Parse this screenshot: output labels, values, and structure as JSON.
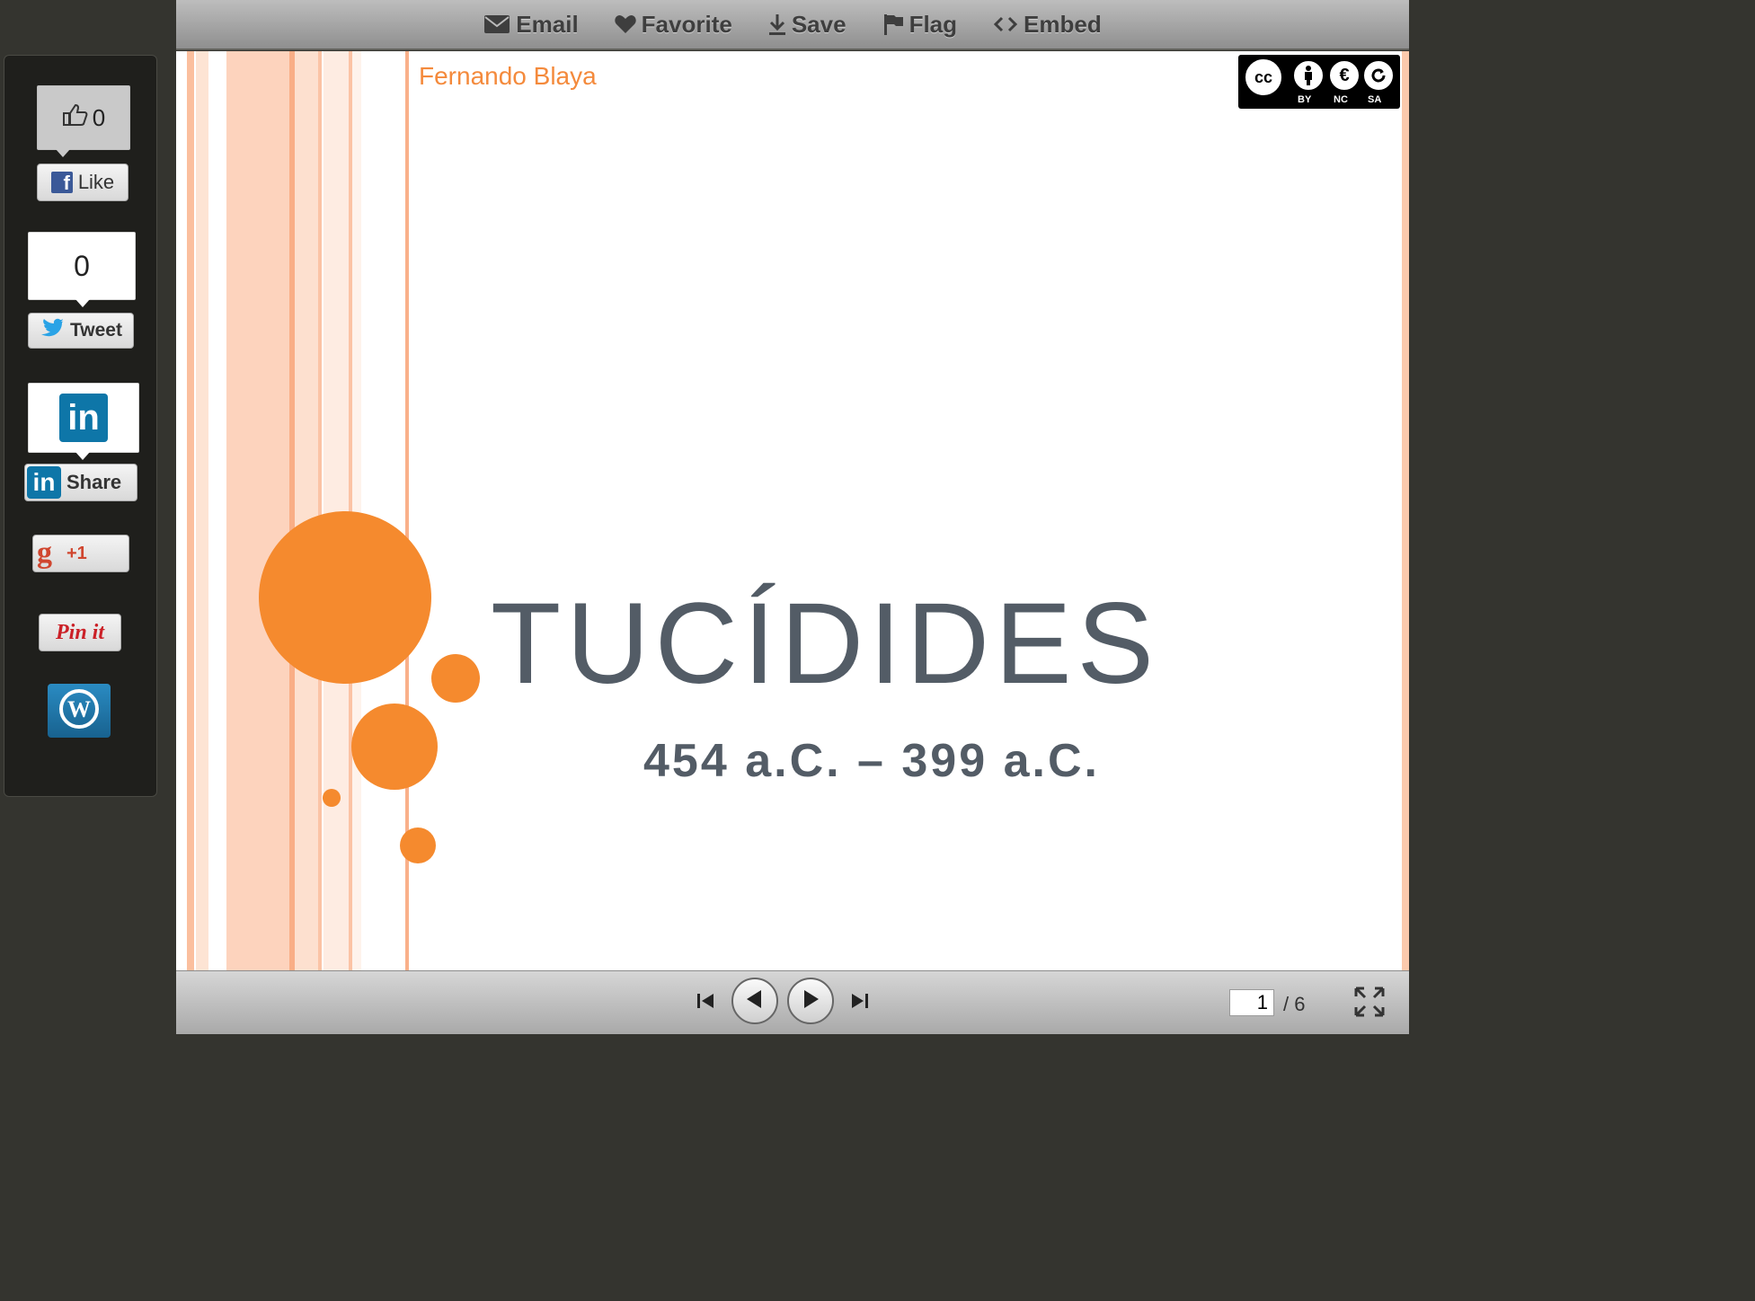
{
  "toolbar": {
    "email": "Email",
    "favorite": "Favorite",
    "save": "Save",
    "flag": "Flag",
    "embed": "Embed"
  },
  "social": {
    "like_count": "0",
    "like_label": "Like",
    "tweet_count": "0",
    "tweet_label": "Tweet",
    "linkedin_badge": "in",
    "share_label": "Share",
    "gplus_label": "+1",
    "pin_label": "Pin it"
  },
  "slide": {
    "author": "Fernando Blaya",
    "title": "TUCÍDIDES",
    "dates": "454 a.C. – 399 a.C.",
    "license": {
      "cc": "cc",
      "by": "BY",
      "nc": "NC",
      "sa": "SA"
    },
    "accent_color": "#f58a2e",
    "text_color": "#535c66"
  },
  "navigation": {
    "current_page": "1",
    "total_pages": "/ 6"
  }
}
